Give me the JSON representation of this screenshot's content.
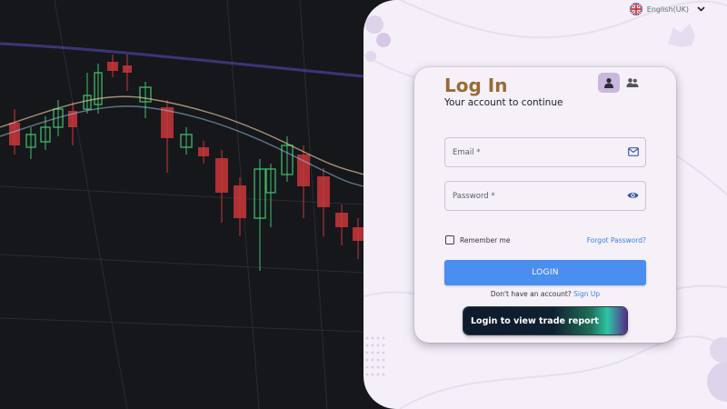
{
  "header": {
    "language": {
      "label": "English(UK)",
      "flag_icon": "uk-flag-icon",
      "dropdown_icon": "chevron-down-icon"
    }
  },
  "login_card": {
    "title": "Log In",
    "subtitle": "Your account to continue",
    "role_toggle": {
      "options": [
        {
          "icon": "single-user-icon",
          "active": true
        },
        {
          "icon": "user-group-icon",
          "active": false
        }
      ]
    },
    "email": {
      "placeholder": "Email *",
      "value": "",
      "icon": "mail-icon"
    },
    "password": {
      "placeholder": "Password *",
      "value": "",
      "icon": "eye-icon"
    },
    "remember_me": {
      "label": "Remember me",
      "checked": false
    },
    "forgot_password": "Forgot Password?",
    "login_button": "LOGIN",
    "signup_prompt": "Don't have an account?",
    "signup_link": "Sign Up",
    "trade_report_button": "Login to view trade report"
  },
  "colors": {
    "accent_blue": "#4a8ef0",
    "link_blue": "#3b82e0",
    "title_brown": "#9a6a33",
    "panel_background": "#f4eff8",
    "chart_background": "#16171b",
    "candle_up": "#3fbf6a",
    "candle_down": "#c8363a"
  }
}
